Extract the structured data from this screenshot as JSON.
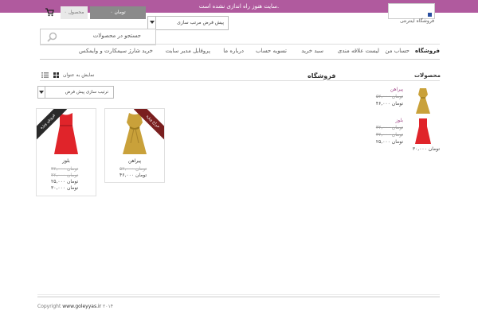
{
  "notice": "سایت هنوز راه اندازی نشده است.",
  "header": {
    "cart_count": "۰ محصول",
    "cart_price": "۰ تومان",
    "sort_select": "پیش فرض مرتب سازی",
    "site_name": "فروشگاه اینترنتی",
    "search_placeholder": "جستجو در محصولات"
  },
  "nav": [
    {
      "label": "فروشگاه"
    },
    {
      "label": "حساب من"
    },
    {
      "label": "لیست علاقه مندی"
    },
    {
      "label": "سبد خرید"
    },
    {
      "label": "تسویه حساب"
    },
    {
      "label": "درباره ما"
    },
    {
      "label": "پروفایل مدیر سایت"
    },
    {
      "label": "خرید شارژ سیمکارت و وایمکس"
    }
  ],
  "sidebar": {
    "title": "محصولات",
    "products": [
      {
        "name": "پیراهن",
        "old_price": "۵۲,۰۰۰ تومان",
        "new_price": "۴۶,۰۰۰ تومان",
        "color": "#c9a13a"
      },
      {
        "name": "بلوز",
        "old_price": "۳۲,۰۰۰ تومان",
        "mid_price": "۳۲,۰۰۰ تومان",
        "new_price": "۲۵,۰۰۰ تومان",
        "extra_price": "۳۰,۰۰۰ تومان",
        "color": "#e0242a"
      }
    ]
  },
  "main": {
    "title": "فروشگاه",
    "view_label": "نمایش به عنوان",
    "sort_select": "ترتیب سازی پیش فرض",
    "products": [
      {
        "name": "پیراهن",
        "badge": "حراج ویژه",
        "old_price": "۵۲,۰۰۰ تومان",
        "new_price": "۴۶,۰۰۰ تومان",
        "color": "#c9a13a"
      },
      {
        "name": "بلوز",
        "badge": "فروش ویژه",
        "old_price": "۳۲,۰۰۰ تومان",
        "old_price2": "۳۲,۰۰۰ تومان",
        "new_price": "۲۵,۰۰۰ تومان",
        "new_price2": "۳۰,۰۰۰ تومان",
        "color": "#e0242a"
      }
    ]
  },
  "footer": {
    "prefix": "Copyright",
    "domain": "www.goleyyas.ir",
    "year": "۲۰۱۴"
  }
}
